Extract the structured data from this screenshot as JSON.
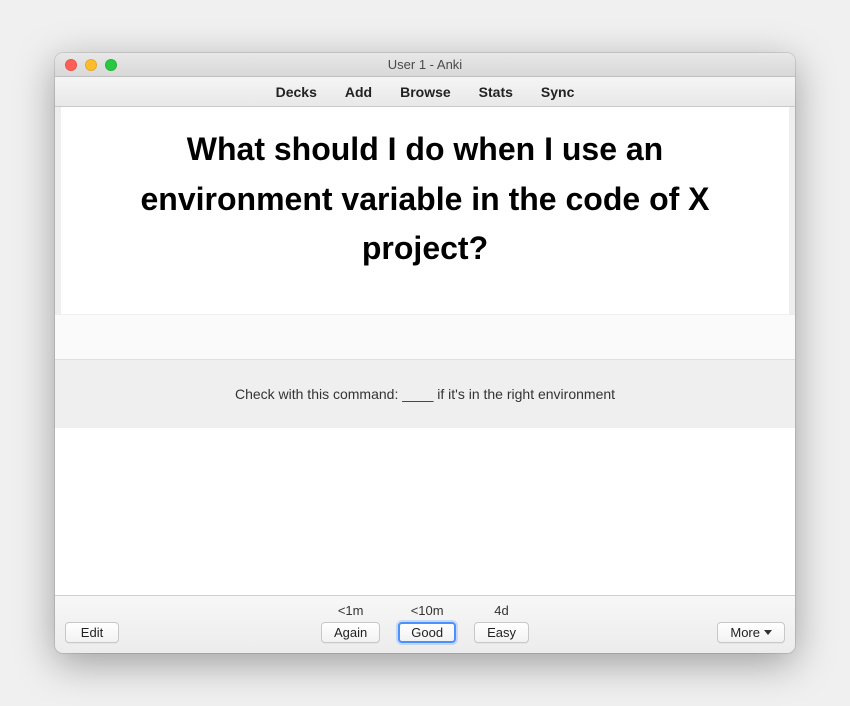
{
  "window": {
    "title": "User 1 - Anki"
  },
  "toolbar": {
    "decks": "Decks",
    "add": "Add",
    "browse": "Browse",
    "stats": "Stats",
    "sync": "Sync"
  },
  "card": {
    "question": "What should I do when I use an environment variable in the code of X project?",
    "answer": "Check with this command: ____ if it's in the right environment"
  },
  "review": {
    "buttons": [
      {
        "interval": "<1m",
        "label": "Again",
        "focused": false
      },
      {
        "interval": "<10m",
        "label": "Good",
        "focused": true
      },
      {
        "interval": "4d",
        "label": "Easy",
        "focused": false
      }
    ],
    "edit": "Edit",
    "more": "More"
  }
}
